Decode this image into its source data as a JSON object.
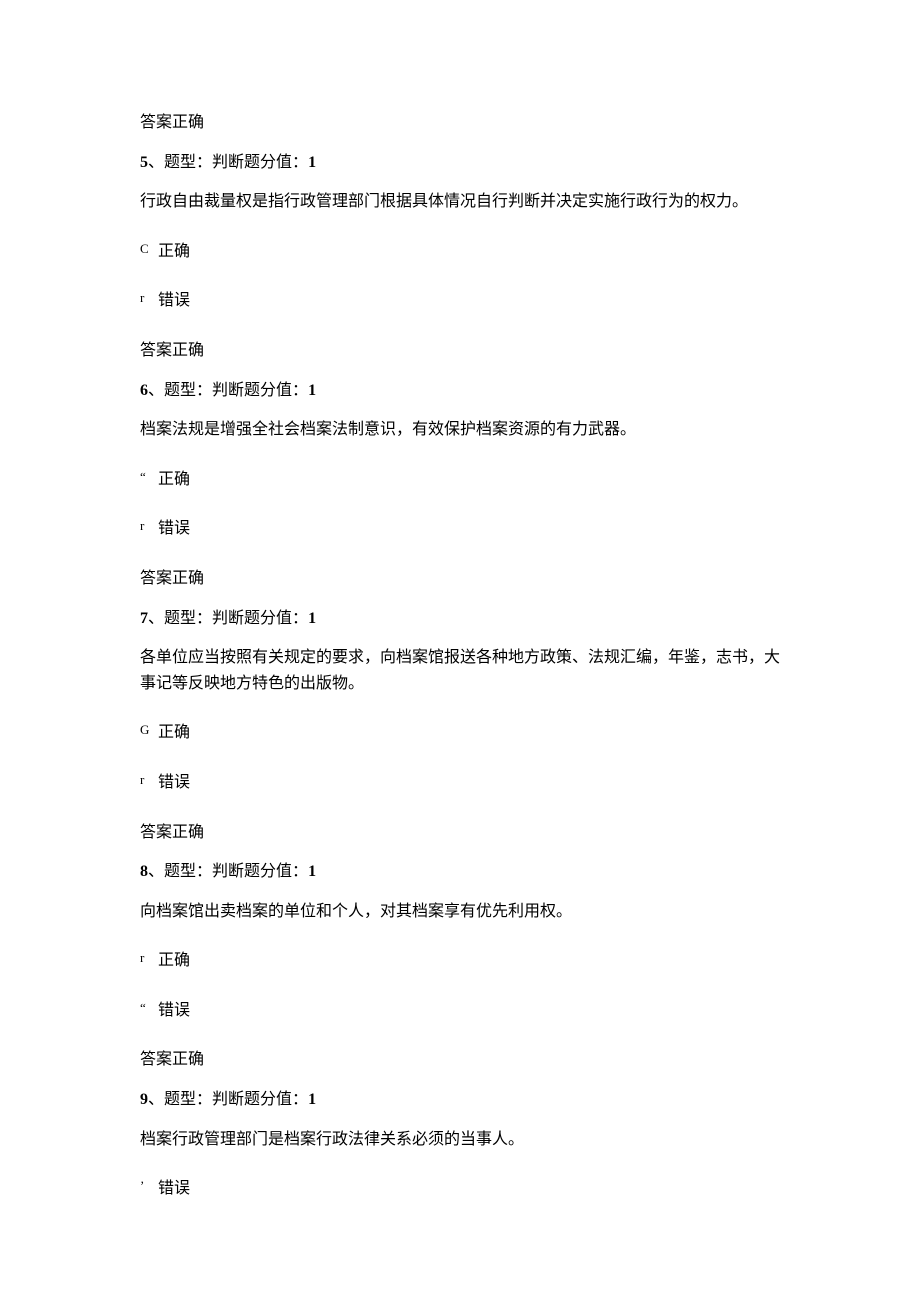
{
  "answer_label": "答案正确",
  "header_parts": {
    "sep": "、",
    "type_label": "题型：",
    "type_value": "判断题",
    "score_label": "分值：",
    "score_value": "1"
  },
  "opt_correct": "正确",
  "opt_wrong": "错误",
  "questions": [
    {
      "num": "5",
      "text": "行政自由裁量权是指行政管理部门根据具体情况自行判断并决定实施行政行为的权力。",
      "options": [
        {
          "marker": "C",
          "text_key": "opt_correct"
        },
        {
          "marker": "r",
          "text_key": "opt_wrong"
        }
      ]
    },
    {
      "num": "6",
      "text": "档案法规是增强全社会档案法制意识，有效保护档案资源的有力武器。",
      "options": [
        {
          "marker": "“",
          "text_key": "opt_correct"
        },
        {
          "marker": "r",
          "text_key": "opt_wrong"
        }
      ]
    },
    {
      "num": "7",
      "text": "各单位应当按照有关规定的要求，向档案馆报送各种地方政策、法规汇编，年鉴，志书，大事记等反映地方特色的出版物。",
      "options": [
        {
          "marker": "G",
          "text_key": "opt_correct"
        },
        {
          "marker": "r",
          "text_key": "opt_wrong"
        }
      ]
    },
    {
      "num": "8",
      "text": "向档案馆出卖档案的单位和个人，对其档案享有优先利用权。",
      "options": [
        {
          "marker": "r",
          "text_key": "opt_correct"
        },
        {
          "marker": "“",
          "text_key": "opt_wrong"
        }
      ]
    },
    {
      "num": "9",
      "text": "档案行政管理部门是档案行政法律关系必须的当事人。",
      "options": [
        {
          "marker": "’",
          "text_key": "opt_wrong"
        }
      ],
      "no_trailing_answer": true
    }
  ]
}
